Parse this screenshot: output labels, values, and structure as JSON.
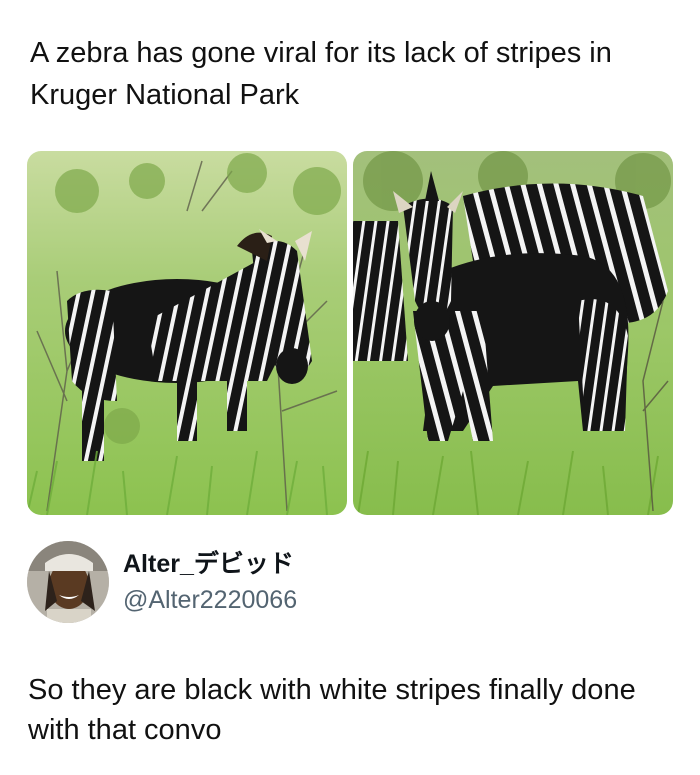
{
  "headline": "A zebra has gone viral for its lack of stripes in Kruger National Park",
  "author": {
    "display_name": "Alter_デビッド",
    "handle": "@Alter2220066"
  },
  "post_text": "So they are black with white stripes finally done with that convo",
  "colors": {
    "text": "#111111",
    "handle": "#536471",
    "grass": "#9dc56a",
    "zebra_black": "#161616"
  },
  "images": [
    {
      "icon": "zebra-photo-left"
    },
    {
      "icon": "zebra-photo-right"
    }
  ]
}
